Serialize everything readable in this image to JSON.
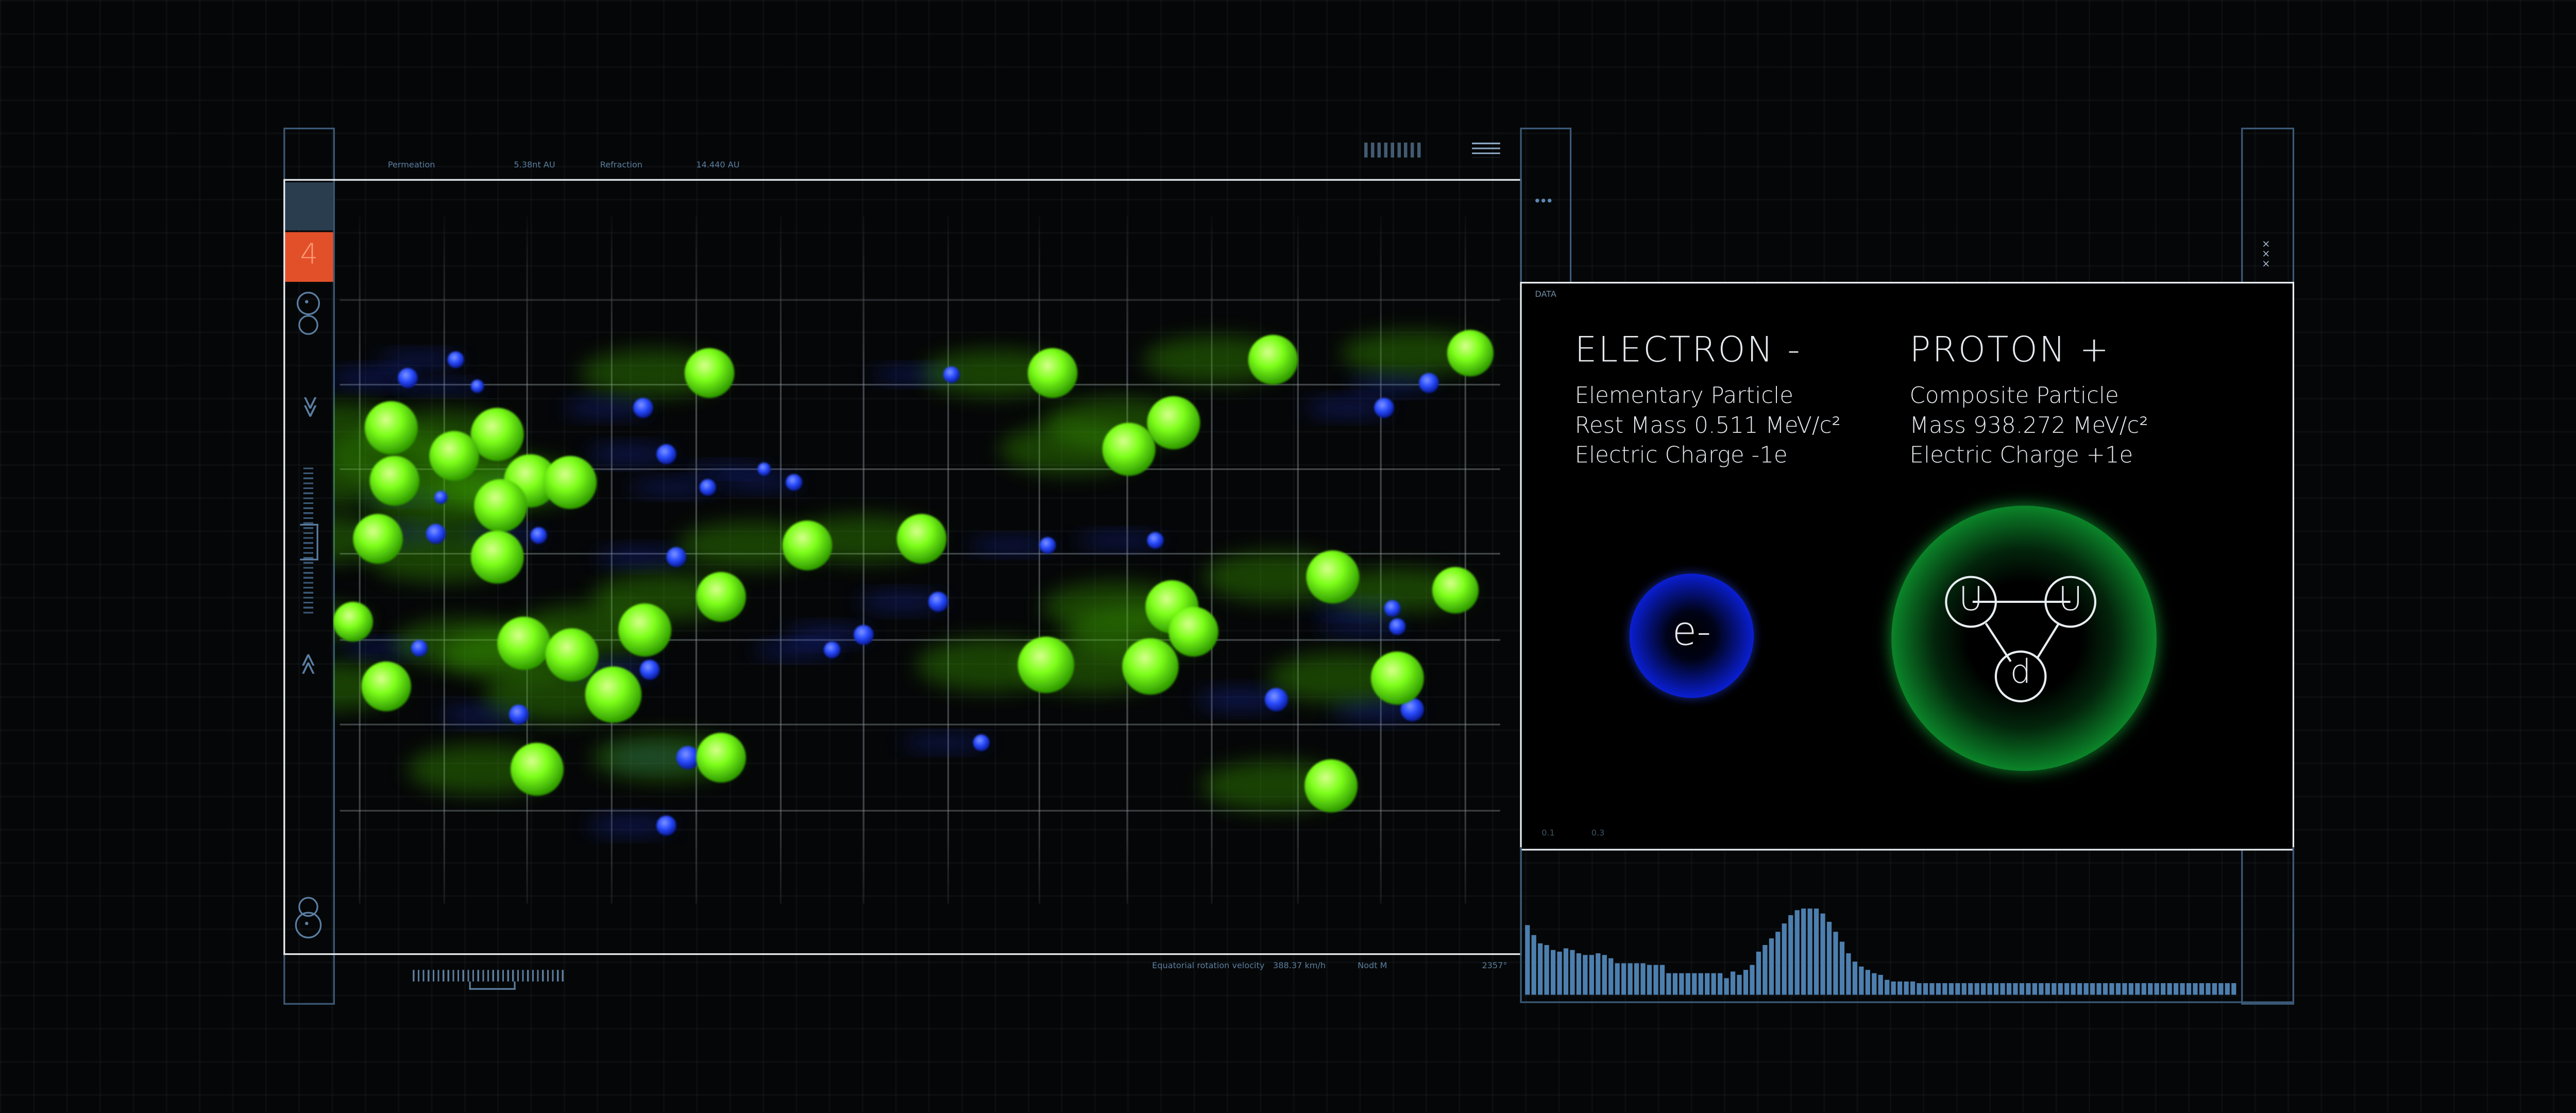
{
  "sim": {
    "label_a": "Permeation",
    "value_a": "5.38nt AU",
    "label_b": "Refraction",
    "value_b": "14.440 AU",
    "footer_label": "Equatorial rotation velocity",
    "footer_value": "388.37 km/h",
    "footer_unit": "Nodt M",
    "footer_temp": "2357°",
    "channel": "4"
  },
  "data_panel": {
    "label": "DATA",
    "menu_glyph": "•••",
    "close_glyph": "×\n×\n×",
    "axis_a": "0.1",
    "axis_b": "0.3",
    "electron": {
      "title": "ELECTRON -",
      "line1": "Elementary Particle",
      "line2": "Rest Mass 0.511 MeV/c²",
      "line3": "Electric Charge -1e",
      "symbol": "e-"
    },
    "proton": {
      "title": "PROTON +",
      "line1": "Composite Particle",
      "line2": "Mass 938.272 MeV/c²",
      "line3": "Electric Charge +1e",
      "quark_1": "U",
      "quark_2": "U",
      "quark_3": "d"
    }
  },
  "icons": {
    "chevron_down": "≫",
    "chevron_up": "≫"
  },
  "histogram": {
    "bar_color": "#4d7fae",
    "values": [
      42,
      36,
      31,
      30,
      27,
      26,
      28,
      27,
      25,
      24,
      24,
      25,
      24,
      22,
      19,
      19,
      19,
      19,
      19,
      18,
      18,
      18,
      13,
      13,
      13,
      13,
      13,
      13,
      13,
      13,
      13,
      10,
      14,
      12,
      15,
      18,
      26,
      30,
      34,
      38,
      43,
      48,
      51,
      52,
      52,
      52,
      49,
      44,
      38,
      32,
      25,
      20,
      17,
      15,
      13,
      12,
      9,
      8,
      8,
      8,
      8,
      7,
      7,
      7,
      7,
      7,
      7,
      7,
      7,
      7,
      7,
      7,
      7,
      7,
      7,
      7,
      7,
      7,
      7,
      7,
      7,
      7,
      7,
      7,
      7,
      7,
      7,
      7,
      7,
      7,
      7,
      7,
      7,
      7,
      7,
      7,
      7,
      7,
      7,
      7,
      7,
      7,
      7,
      7,
      7,
      7,
      7,
      7,
      7,
      7,
      7
    ]
  },
  "particles": {
    "green": "#7dff1a",
    "blue": "#2a4dff",
    "green_particles": [
      [
        428,
        225,
        15
      ],
      [
        635,
        225,
        15
      ],
      [
        768,
        217,
        15
      ],
      [
        887,
        213,
        14
      ],
      [
        300,
        262,
        16
      ],
      [
        274,
        275,
        15
      ],
      [
        708,
        255,
        16
      ],
      [
        681,
        271,
        16
      ],
      [
        320,
        290,
        16
      ],
      [
        344,
        291,
        16
      ],
      [
        302,
        305,
        16
      ],
      [
        236,
        258,
        16
      ],
      [
        238,
        290,
        15
      ],
      [
        228,
        325,
        15
      ],
      [
        300,
        336,
        16
      ],
      [
        487,
        329,
        15
      ],
      [
        556,
        325,
        15
      ],
      [
        804,
        348,
        16
      ],
      [
        878,
        356,
        14
      ],
      [
        435,
        360,
        15
      ],
      [
        707,
        366,
        16
      ],
      [
        720,
        381,
        15
      ],
      [
        389,
        380,
        16
      ],
      [
        316,
        388,
        16
      ],
      [
        345,
        395,
        16
      ],
      [
        631,
        401,
        17
      ],
      [
        694,
        402,
        17
      ],
      [
        843,
        409,
        16
      ],
      [
        370,
        419,
        17
      ],
      [
        233,
        414,
        15
      ],
      [
        435,
        457,
        15
      ],
      [
        324,
        464,
        16
      ],
      [
        803,
        474,
        16
      ],
      [
        213,
        375,
        12
      ]
    ],
    "blue_particles": [
      [
        275,
        217,
        5
      ],
      [
        246,
        228,
        6
      ],
      [
        288,
        233,
        4
      ],
      [
        388,
        246,
        6
      ],
      [
        574,
        226,
        5
      ],
      [
        835,
        246,
        6
      ],
      [
        862,
        231,
        6
      ],
      [
        402,
        274,
        6
      ],
      [
        461,
        283,
        4
      ],
      [
        479,
        291,
        5
      ],
      [
        427,
        294,
        5
      ],
      [
        336,
        294,
        6
      ],
      [
        266,
        300,
        4
      ],
      [
        263,
        322,
        6
      ],
      [
        325,
        323,
        5
      ],
      [
        408,
        336,
        6
      ],
      [
        632,
        329,
        5
      ],
      [
        697,
        326,
        5
      ],
      [
        566,
        363,
        6
      ],
      [
        521,
        383,
        6
      ],
      [
        502,
        392,
        5
      ],
      [
        392,
        404,
        6
      ],
      [
        840,
        367,
        5
      ],
      [
        843,
        378,
        5
      ],
      [
        253,
        391,
        5
      ],
      [
        770,
        422,
        7
      ],
      [
        852,
        428,
        7
      ],
      [
        313,
        431,
        6
      ],
      [
        415,
        457,
        7
      ],
      [
        592,
        448,
        5
      ],
      [
        402,
        498,
        6
      ]
    ]
  }
}
